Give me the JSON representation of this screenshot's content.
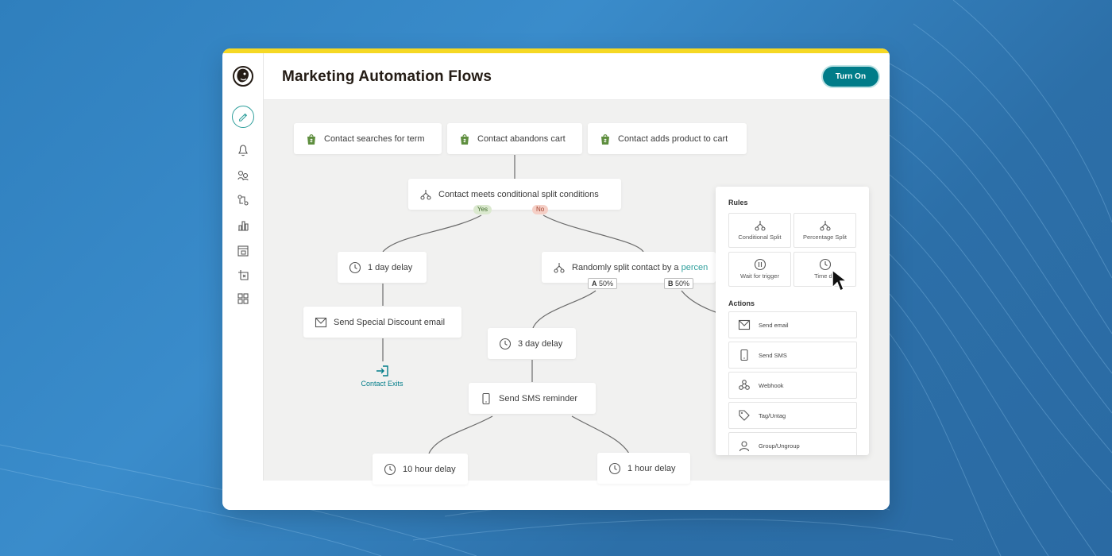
{
  "header": {
    "title": "Marketing Automation Flows",
    "turn_on_label": "Turn On"
  },
  "sidebar": {
    "items": [
      "edit-icon",
      "bell-icon",
      "audience-icon",
      "automation-icon",
      "reports-icon",
      "content-icon",
      "website-icon",
      "grid-icon"
    ]
  },
  "flow": {
    "triggers": [
      "Contact searches for term",
      "Contact abandons cart",
      "Contact adds product to cart"
    ],
    "conditional_split": "Contact meets conditional split conditions",
    "yes_label": "Yes",
    "no_label": "No",
    "delay_1_day": "1 day delay",
    "send_discount": "Send Special Discount email",
    "contact_exits": "Contact Exits",
    "random_split_prefix": "Randomly split contact by a ",
    "random_split_link": "percen",
    "branch_a_letter": "A",
    "branch_a_pct": "50%",
    "branch_b_letter": "B",
    "branch_b_pct": "50%",
    "delay_3_day": "3 day delay",
    "send_sms": "Send SMS reminder",
    "delay_10_hour": "10 hour delay",
    "delay_1_hour": "1 hour delay"
  },
  "panel": {
    "rules_title": "Rules",
    "rules": [
      "Conditional Split",
      "Percentage Split",
      "Wait for trigger",
      "Time de"
    ],
    "actions_title": "Actions",
    "actions": [
      "Send email",
      "Send SMS",
      "Webhook",
      "Tag/Untag",
      "Group/Ungroup"
    ]
  },
  "colors": {
    "accent_teal": "#007c89",
    "brand_yellow": "#f5d824",
    "shopify_green": "#5e8e3e"
  }
}
